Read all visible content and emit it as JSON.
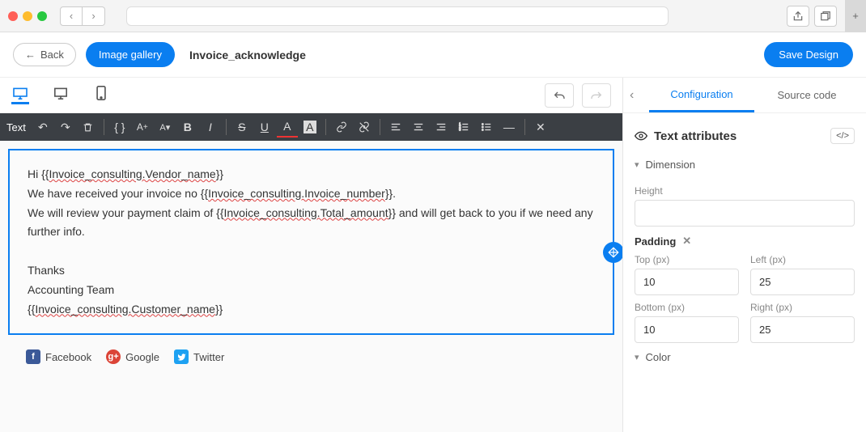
{
  "header": {
    "back_label": "Back",
    "gallery_label": "Image gallery",
    "title": "Invoice_acknowledge",
    "save_label": "Save Design"
  },
  "toolbar": {
    "label": "Text"
  },
  "content": {
    "line1_pre": "Hi {{",
    "line1_var": "Invoice_consulting.Vendor_name",
    "line1_post": "}}",
    "line2_pre": "We have received your invoice no {{",
    "line2_var": "Invoice_consulting.Invoice_number",
    "line2_post": "}}.",
    "line3_pre": "We will review your payment claim of {{",
    "line3_var": "Invoice_consulting.Total_amount",
    "line3_post": "}} and will get back to you if we need any further info.",
    "thanks": "Thanks",
    "team": "Accounting Team",
    "sig_pre": "{{",
    "sig_var": "Invoice_consulting.Customer_name",
    "sig_post": "}}"
  },
  "social": {
    "facebook": "Facebook",
    "google": "Google",
    "twitter": "Twitter"
  },
  "panel": {
    "tab_config": "Configuration",
    "tab_source": "Source code",
    "section_title": "Text attributes",
    "dimension": "Dimension",
    "height_label": "Height",
    "padding_label": "Padding",
    "top_label": "Top (px)",
    "left_label": "Left (px)",
    "bottom_label": "Bottom (px)",
    "right_label": "Right (px)",
    "top_val": "10",
    "left_val": "25",
    "bottom_val": "10",
    "right_val": "25",
    "color": "Color"
  }
}
